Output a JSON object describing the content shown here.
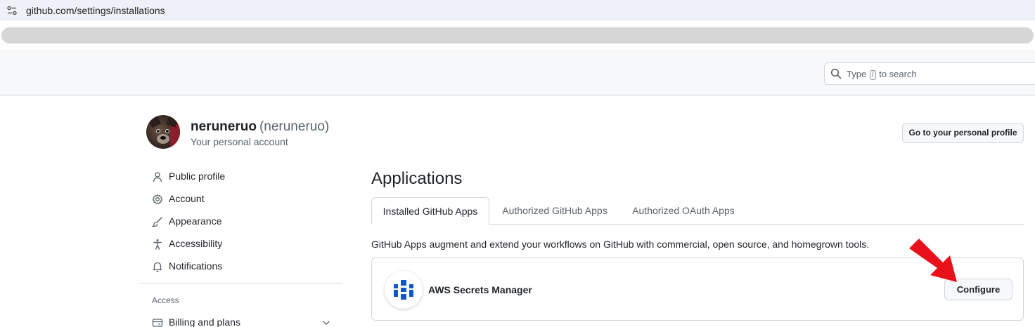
{
  "browser": {
    "url": "github.com/settings/installations"
  },
  "header": {
    "search_placeholder_before": "Type",
    "search_key": "/",
    "search_placeholder_after": "to search"
  },
  "account": {
    "name": "neruneruo",
    "login": "(neruneruo)",
    "subtitle": "Your personal account",
    "profile_button": "Go to your personal profile"
  },
  "sidebar": {
    "items": [
      {
        "label": "Public profile",
        "icon": "person-icon"
      },
      {
        "label": "Account",
        "icon": "gear-icon"
      },
      {
        "label": "Appearance",
        "icon": "paintbrush-icon"
      },
      {
        "label": "Accessibility",
        "icon": "accessibility-icon"
      },
      {
        "label": "Notifications",
        "icon": "bell-icon"
      }
    ],
    "access_heading": "Access",
    "billing": {
      "label": "Billing and plans",
      "icon": "credit-card-icon"
    }
  },
  "main": {
    "title": "Applications",
    "tabs": [
      {
        "label": "Installed GitHub Apps",
        "active": true
      },
      {
        "label": "Authorized GitHub Apps",
        "active": false
      },
      {
        "label": "Authorized OAuth Apps",
        "active": false
      }
    ],
    "description": "GitHub Apps augment and extend your workflows on GitHub with commercial, open source, and homegrown tools.",
    "apps": [
      {
        "name": "AWS Secrets Manager",
        "button": "Configure"
      }
    ]
  },
  "colors": {
    "accent_arrow": "#e8101a",
    "app_logo_blue": "#1158c7"
  }
}
